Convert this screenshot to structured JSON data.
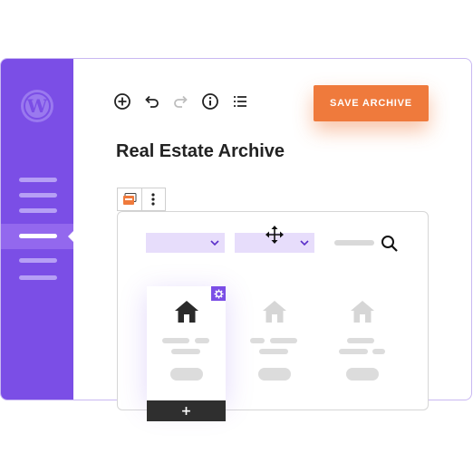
{
  "sidebar": {
    "logo": "wordpress-logo",
    "items": [
      "menu-item-1",
      "menu-item-2",
      "menu-item-3",
      "menu-item-active",
      "menu-item-5",
      "menu-item-6"
    ]
  },
  "toolbar": {
    "icons": [
      "add-circle-icon",
      "undo-icon",
      "redo-icon",
      "info-icon",
      "list-view-icon"
    ],
    "save_label": "SAVE ARCHIVE"
  },
  "page": {
    "title": "Real Estate Archive"
  },
  "block": {
    "toolbar_icons": [
      "archive-block-icon",
      "more-options-icon"
    ],
    "filters": [
      "filter-select",
      "filter-select"
    ],
    "cards": 3,
    "add_label": "+"
  },
  "colors": {
    "sidebar": "#7b4ee6",
    "accent_button": "#ef7a3c",
    "select_bg": "#e7ddfb",
    "placeholder": "#dcdcdc",
    "house_selected": "#2a2a2a",
    "house_muted": "#d6d6d6"
  }
}
